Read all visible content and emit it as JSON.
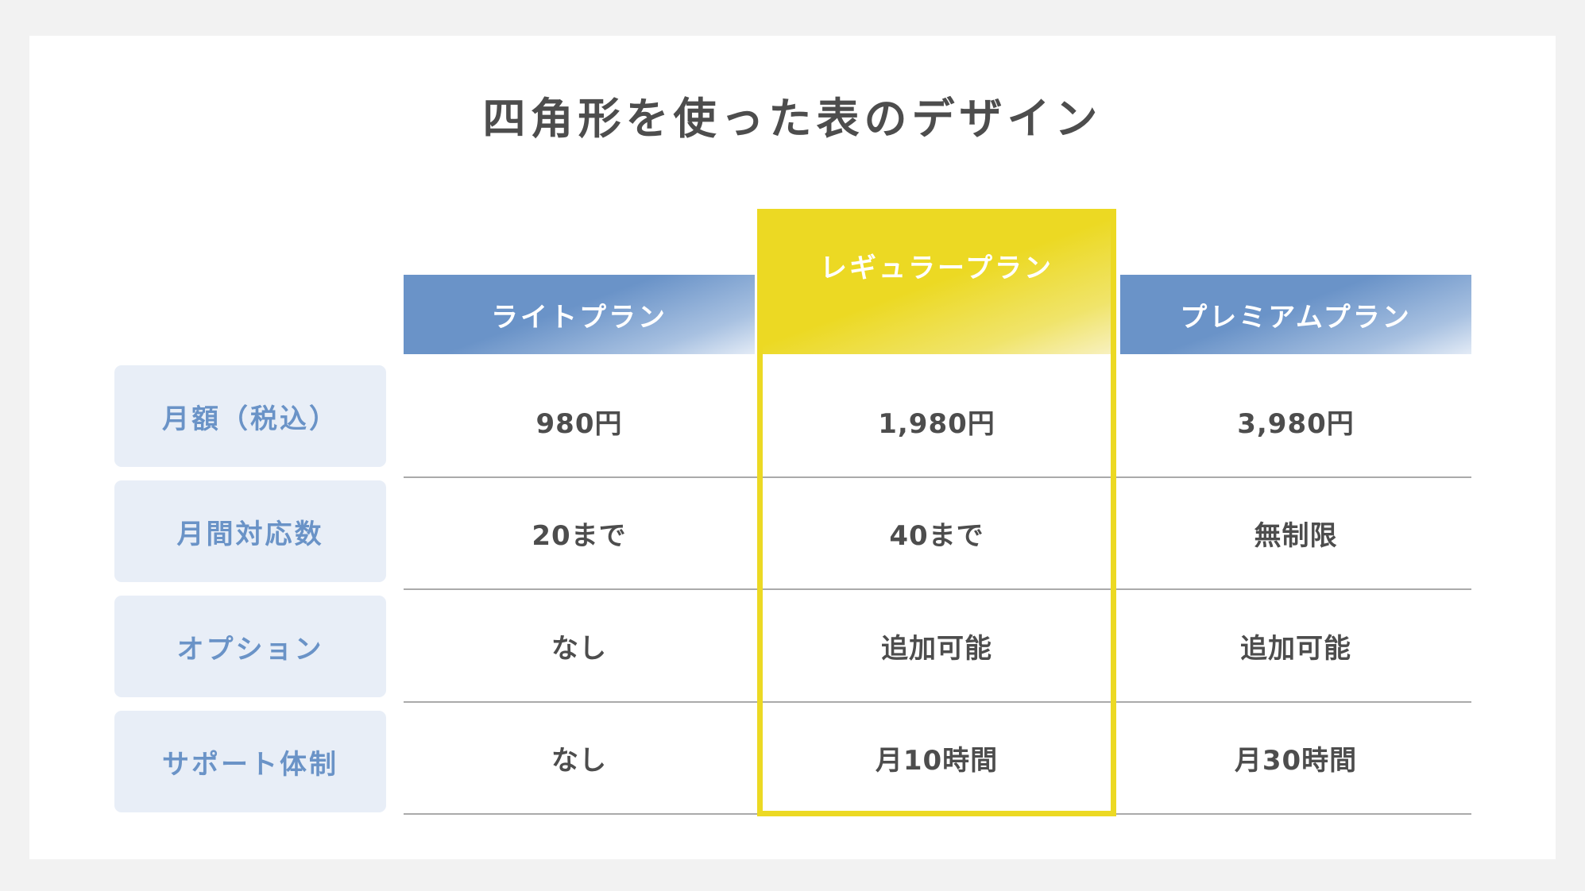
{
  "title": "四角形を使った表のデザイン",
  "colors": {
    "page_background": "#f2f2f2",
    "card_background": "#ffffff",
    "header_blue": "#6a93c8",
    "header_yellow": "#ecd923",
    "row_label_bg": "#e8eef7",
    "row_label_text": "#6a93c7",
    "cell_text": "#4d4d4d",
    "separator": "#aaaaaa"
  },
  "table": {
    "columns": [
      {
        "label": "ライトプラン",
        "highlighted": false
      },
      {
        "label": "レギュラープラン",
        "highlighted": true
      },
      {
        "label": "プレミアムプラン",
        "highlighted": false
      }
    ],
    "rows": [
      {
        "label": "月額（税込）",
        "values": [
          "980円",
          "1,980円",
          "3,980円"
        ]
      },
      {
        "label": "月間対応数",
        "values": [
          "20まで",
          "40まで",
          "無制限"
        ]
      },
      {
        "label": "オプション",
        "values": [
          "なし",
          "追加可能",
          "追加可能"
        ]
      },
      {
        "label": "サポート体制",
        "values": [
          "なし",
          "月10時間",
          "月30時間"
        ]
      }
    ]
  }
}
